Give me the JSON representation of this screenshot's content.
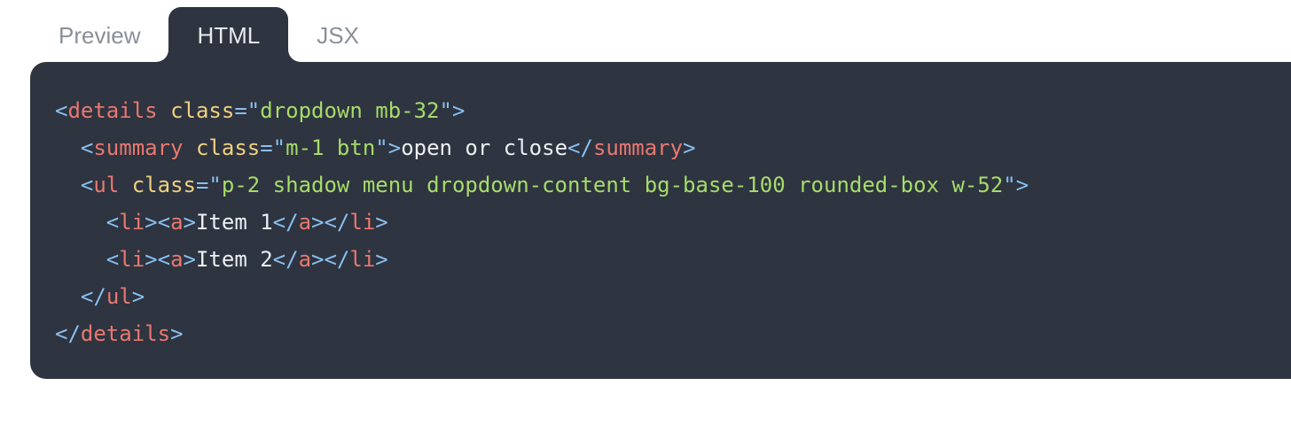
{
  "tabs": [
    {
      "label": "Preview",
      "active": false
    },
    {
      "label": "HTML",
      "active": true
    },
    {
      "label": "JSX",
      "active": false
    }
  ],
  "code": {
    "lines": [
      {
        "indent": "",
        "parts": [
          {
            "k": "p",
            "v": "<"
          },
          {
            "k": "t",
            "v": "details"
          },
          {
            "k": "x",
            "v": " "
          },
          {
            "k": "a",
            "v": "class"
          },
          {
            "k": "p",
            "v": "=\""
          },
          {
            "k": "s",
            "v": "dropdown mb-32"
          },
          {
            "k": "p",
            "v": "\">"
          }
        ]
      },
      {
        "indent": "  ",
        "parts": [
          {
            "k": "p",
            "v": "<"
          },
          {
            "k": "t",
            "v": "summary"
          },
          {
            "k": "x",
            "v": " "
          },
          {
            "k": "a",
            "v": "class"
          },
          {
            "k": "p",
            "v": "=\""
          },
          {
            "k": "s",
            "v": "m-1 btn"
          },
          {
            "k": "p",
            "v": "\">"
          },
          {
            "k": "x",
            "v": "open or close"
          },
          {
            "k": "p",
            "v": "</"
          },
          {
            "k": "t",
            "v": "summary"
          },
          {
            "k": "p",
            "v": ">"
          }
        ]
      },
      {
        "indent": "  ",
        "parts": [
          {
            "k": "p",
            "v": "<"
          },
          {
            "k": "t",
            "v": "ul"
          },
          {
            "k": "x",
            "v": " "
          },
          {
            "k": "a",
            "v": "class"
          },
          {
            "k": "p",
            "v": "=\""
          },
          {
            "k": "s",
            "v": "p-2 shadow menu dropdown-content bg-base-100 rounded-box w-52"
          },
          {
            "k": "p",
            "v": "\">"
          }
        ]
      },
      {
        "indent": "    ",
        "parts": [
          {
            "k": "p",
            "v": "<"
          },
          {
            "k": "t",
            "v": "li"
          },
          {
            "k": "p",
            "v": ">"
          },
          {
            "k": "p",
            "v": "<"
          },
          {
            "k": "t",
            "v": "a"
          },
          {
            "k": "p",
            "v": ">"
          },
          {
            "k": "x",
            "v": "Item 1"
          },
          {
            "k": "p",
            "v": "</"
          },
          {
            "k": "t",
            "v": "a"
          },
          {
            "k": "p",
            "v": ">"
          },
          {
            "k": "p",
            "v": "</"
          },
          {
            "k": "t",
            "v": "li"
          },
          {
            "k": "p",
            "v": ">"
          }
        ]
      },
      {
        "indent": "    ",
        "parts": [
          {
            "k": "p",
            "v": "<"
          },
          {
            "k": "t",
            "v": "li"
          },
          {
            "k": "p",
            "v": ">"
          },
          {
            "k": "p",
            "v": "<"
          },
          {
            "k": "t",
            "v": "a"
          },
          {
            "k": "p",
            "v": ">"
          },
          {
            "k": "x",
            "v": "Item 2"
          },
          {
            "k": "p",
            "v": "</"
          },
          {
            "k": "t",
            "v": "a"
          },
          {
            "k": "p",
            "v": ">"
          },
          {
            "k": "p",
            "v": "</"
          },
          {
            "k": "t",
            "v": "li"
          },
          {
            "k": "p",
            "v": ">"
          }
        ]
      },
      {
        "indent": "  ",
        "parts": [
          {
            "k": "p",
            "v": "</"
          },
          {
            "k": "t",
            "v": "ul"
          },
          {
            "k": "p",
            "v": ">"
          }
        ]
      },
      {
        "indent": "",
        "parts": [
          {
            "k": "p",
            "v": "</"
          },
          {
            "k": "t",
            "v": "details"
          },
          {
            "k": "p",
            "v": ">"
          }
        ]
      }
    ]
  },
  "colors": {
    "panel_bg": "#2e3440",
    "punctuation": "#88c0f0",
    "tag": "#e9786f",
    "attribute": "#f0d080",
    "string": "#a6dc6a",
    "text": "#eceff4",
    "tab_inactive": "#8a8f99",
    "tab_active": "#e8eaee"
  }
}
